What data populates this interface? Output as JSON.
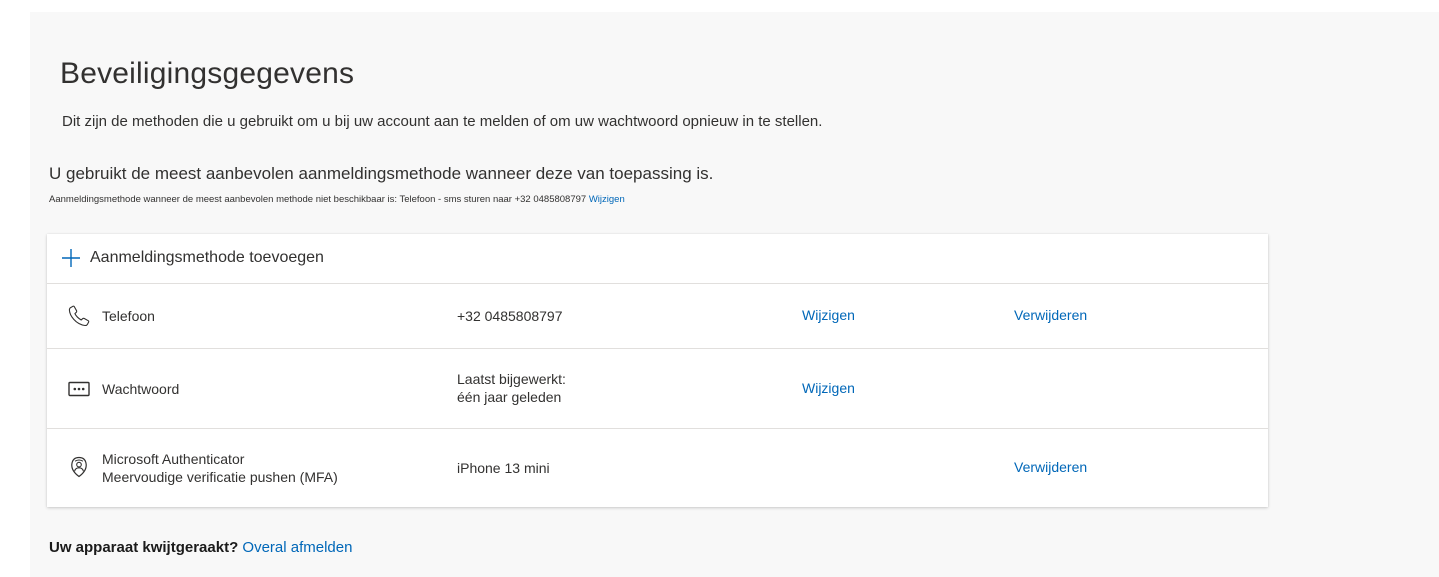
{
  "page": {
    "title": "Beveiligingsgegevens",
    "subtitle": "Dit zijn de methoden die u gebruikt om u bij uw account aan te melden of om uw wachtwoord opnieuw in te stellen."
  },
  "default_method": {
    "heading": "U gebruikt de meest aanbevolen aanmeldingsmethode wanneer deze van toepassing is.",
    "line": "Aanmeldingsmethode wanneer de meest aanbevolen methode niet beschikbaar is: Telefoon - sms sturen naar +32 0485808797",
    "change_link": "Wijzigen"
  },
  "methods_card": {
    "add_label": "Aanmeldingsmethode toevoegen",
    "add_icon": "plus-icon",
    "rows": [
      {
        "icon": "phone-icon",
        "name": "Telefoon",
        "name_line2": "",
        "detail": "+32 0485808797",
        "detail_line2": "",
        "change": "Wijzigen",
        "delete": "Verwijderen"
      },
      {
        "icon": "password-icon",
        "name": "Wachtwoord",
        "name_line2": "",
        "detail": "Laatst bijgewerkt:",
        "detail_line2": "één jaar geleden",
        "change": "Wijzigen",
        "delete": ""
      },
      {
        "icon": "authenticator-icon",
        "name": "Microsoft Authenticator",
        "name_line2": "Meervoudige verificatie pushen (MFA)",
        "detail": "iPhone 13 mini",
        "detail_line2": "",
        "change": "",
        "delete": "Verwijderen"
      }
    ]
  },
  "lost_device": {
    "question": "Uw apparaat kwijtgeraakt?",
    "link": "Overal afmelden"
  },
  "colors": {
    "link": "#0067b8",
    "panel_bg": "#f8f8f8",
    "text": "#323130"
  }
}
